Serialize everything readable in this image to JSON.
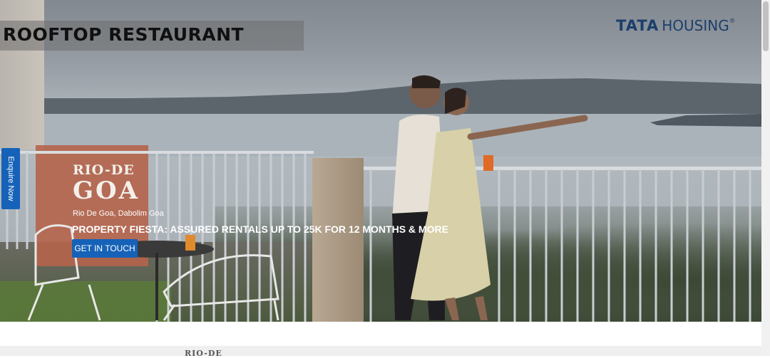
{
  "hero": {
    "title": "ROOFTOP RESTAURANT",
    "brand_primary": "TATA",
    "brand_secondary": "HOUSING",
    "brand_mark": "®",
    "project_name_line1": "RIO-DE",
    "project_name_line2": "GOA",
    "location": "Rio De Goa, Dabolim Goa",
    "offer": "PROPERTY FIESTA: ASSURED RENTALS UP TO 25K FOR 12 MONTHS & MORE",
    "cta_label": "GET IN TOUCH"
  },
  "sidebar": {
    "enquire_label": "Enquire Now"
  },
  "below_fold": {
    "project_name": "RIO-DE"
  },
  "colors": {
    "accent": "#1662b8",
    "brand": "#1b3f6b"
  }
}
